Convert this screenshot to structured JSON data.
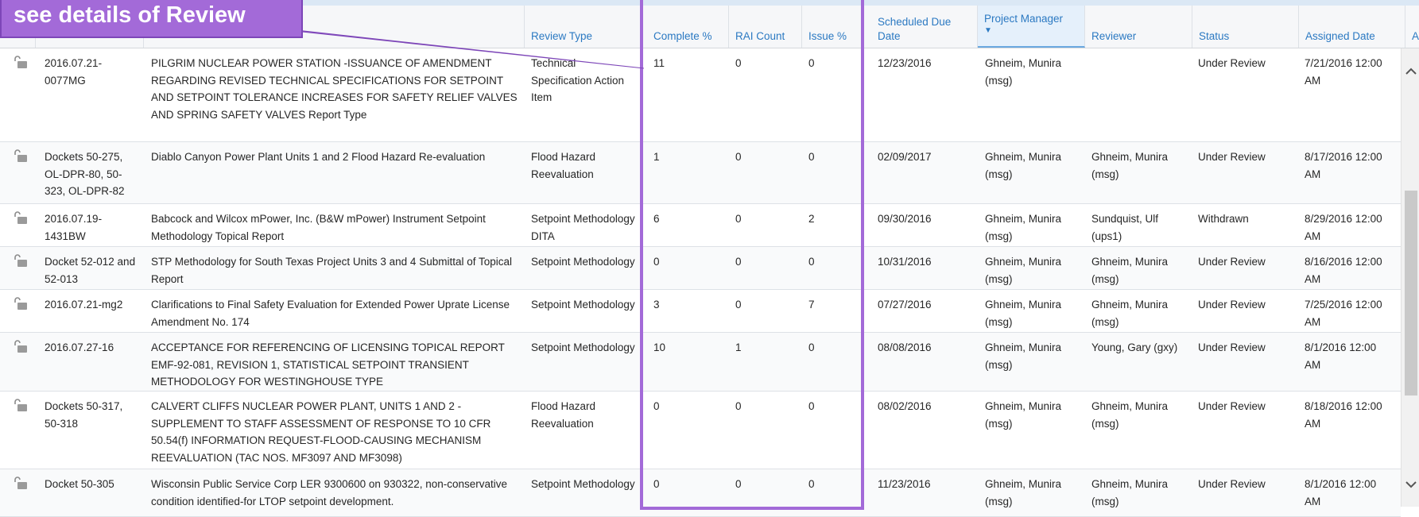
{
  "annotation": {
    "callout_text": "see details of Review",
    "color": "#a36ad8"
  },
  "table": {
    "columns": [
      {
        "label": ""
      },
      {
        "label": ""
      },
      {
        "label": ""
      },
      {
        "label": "Review Type"
      },
      {
        "label": "Complete %"
      },
      {
        "label": "RAI Count"
      },
      {
        "label": "Issue %"
      },
      {
        "label": "Scheduled Due Date"
      },
      {
        "label": "Project Manager",
        "sort_indicator": "▼"
      },
      {
        "label": "Reviewer"
      },
      {
        "label": "Status"
      },
      {
        "label": "Assigned Date"
      },
      {
        "label": "A"
      }
    ],
    "rows": [
      {
        "id": "2016.07.21-0077MG",
        "title": "PILGRIM NUCLEAR POWER STATION -ISSUANCE OF AMENDMENT REGARDING REVISED TECHNICAL SPECIFICATIONS FOR SETPOINT AND SETPOINT TOLERANCE INCREASES FOR SAFETY RELIEF VALVES AND SPRING SAFETY VALVES Report Type",
        "review_type": "Technical Specification Action Item",
        "complete": "11",
        "rai": "0",
        "issue": "0",
        "due": "12/23/2016",
        "pm": "Ghneim, Munira (msg)",
        "reviewer": "",
        "status": "Under Review",
        "assigned": "7/21/2016 12:00 AM"
      },
      {
        "id": "Dockets 50-275, OL-DPR-80, 50-323, OL-DPR-82",
        "title": "Diablo Canyon Power Plant Units 1 and 2 Flood Hazard Re-evaluation",
        "review_type": "Flood Hazard Reevaluation",
        "complete": "1",
        "rai": "0",
        "issue": "0",
        "due": "02/09/2017",
        "pm": "Ghneim, Munira (msg)",
        "reviewer": "Ghneim, Munira (msg)",
        "status": "Under Review",
        "assigned": "8/17/2016 12:00 AM"
      },
      {
        "id": "2016.07.19-1431BW",
        "title": "Babcock and Wilcox mPower, Inc. (B&W mPower) Instrument Setpoint Methodology Topical Report",
        "review_type": "Setpoint Methodology DITA",
        "complete": "6",
        "rai": "0",
        "issue": "2",
        "due": "09/30/2016",
        "pm": "Ghneim, Munira (msg)",
        "reviewer": "Sundquist, Ulf (ups1)",
        "status": "Withdrawn",
        "assigned": "8/29/2016 12:00 AM"
      },
      {
        "id": "Docket 52-012 and 52-013",
        "title": "STP Methodology for South Texas Project Units 3 and 4 Submittal of Topical Report",
        "review_type": "Setpoint Methodology",
        "complete": "0",
        "rai": "0",
        "issue": "0",
        "due": "10/31/2016",
        "pm": "Ghneim, Munira (msg)",
        "reviewer": "Ghneim, Munira (msg)",
        "status": "Under Review",
        "assigned": "8/16/2016 12:00 AM"
      },
      {
        "id": "2016.07.21-mg2",
        "title": "Clarifications to Final Safety Evaluation for Extended Power Uprate License Amendment No. 174",
        "review_type": "Setpoint Methodology",
        "complete": "3",
        "rai": "0",
        "issue": "7",
        "due": "07/27/2016",
        "pm": "Ghneim, Munira (msg)",
        "reviewer": "Ghneim, Munira (msg)",
        "status": "Under Review",
        "assigned": "7/25/2016 12:00 AM"
      },
      {
        "id": "2016.07.27-16",
        "title": "ACCEPTANCE FOR REFERENCING OF LICENSING TOPICAL REPORT EMF-92-081, REVISION 1, STATISTICAL SETPOINT TRANSIENT METHODOLOGY FOR WESTINGHOUSE TYPE",
        "review_type": "Setpoint Methodology",
        "complete": "10",
        "rai": "1",
        "issue": "0",
        "due": "08/08/2016",
        "pm": "Ghneim, Munira (msg)",
        "reviewer": "Young, Gary (gxy)",
        "status": "Under Review",
        "assigned": "8/1/2016 12:00 AM"
      },
      {
        "id": "Dockets 50-317, 50-318",
        "title": "CALVERT CLIFFS NUCLEAR POWER PLANT, UNITS 1 AND 2 - SUPPLEMENT TO STAFF ASSESSMENT OF RESPONSE TO 10 CFR 50.54(f) INFORMATION REQUEST-FLOOD-CAUSING MECHANISM REEVALUATION (TAC NOS. MF3097 AND MF3098)",
        "review_type": "Flood Hazard Reevaluation",
        "complete": "0",
        "rai": "0",
        "issue": "0",
        "due": "08/02/2016",
        "pm": "Ghneim, Munira (msg)",
        "reviewer": "Ghneim, Munira (msg)",
        "status": "Under Review",
        "assigned": "8/18/2016 12:00 AM"
      },
      {
        "id": "Docket 50-305",
        "title": "Wisconsin Public Service Corp LER 9300600 on 930322, non-conservative condition identified-for LTOP setpoint development.",
        "review_type": "Setpoint Methodology",
        "complete": "0",
        "rai": "0",
        "issue": "0",
        "due": "11/23/2016",
        "pm": "Ghneim, Munira (msg)",
        "reviewer": "Ghneim, Munira (msg)",
        "status": "Under Review",
        "assigned": "8/1/2016 12:00 AM"
      }
    ]
  },
  "icons": {
    "row_icon": "unlock-icon",
    "scroll_up": "chevron-up-icon",
    "scroll_down": "chevron-down-icon"
  }
}
